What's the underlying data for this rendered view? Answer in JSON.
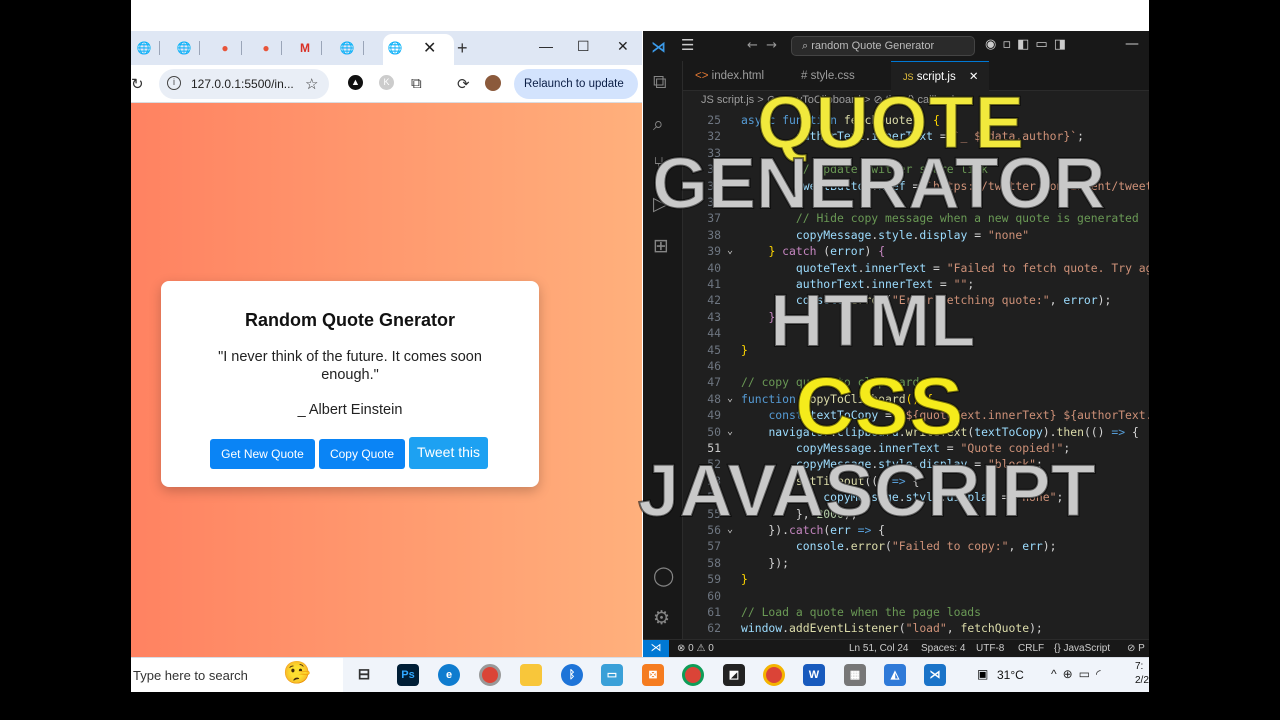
{
  "browser": {
    "url": "127.0.0.1:5500/in...",
    "relaunch_label": "Relaunch to update",
    "profile_letter": "K",
    "tab_icons": [
      "globe-icon",
      "globe-icon",
      "shell-icon",
      "shell-icon",
      "gmail-icon",
      "globe-icon",
      "globe-icon"
    ]
  },
  "app": {
    "title": "Random Quote Gnerator",
    "quote": "\"I never think of the future. It comes soon enough.\"",
    "author": "_ Albert Einstein",
    "btn_new": "Get New Quote",
    "btn_copy": "Copy Quote",
    "btn_tweet": "Tweet this",
    "gradient": [
      "#ff8261",
      "#ffb07c"
    ]
  },
  "vscode": {
    "search": "random Quote Generator",
    "tabs": [
      "index.html",
      "style.css",
      "script.js"
    ],
    "breadcrumb": "JS script.js > ⊘ copyToClipboard > ⊘ then() callback",
    "status": {
      "position": "Ln 51, Col 24",
      "spaces": "Spaces: 4",
      "encoding": "UTF-8",
      "eol": "CRLF",
      "language": "{} JavaScript",
      "problems": "⊗ 0 ⚠ 0"
    },
    "line_numbers": [
      "25",
      "32",
      "33",
      "34",
      "35",
      "36",
      "37",
      "38",
      "39",
      "40",
      "41",
      "42",
      "43",
      "44",
      "45",
      "46",
      "47",
      "48",
      "49",
      "50",
      "51",
      "52",
      "53",
      "54",
      "55",
      "56",
      "57",
      "58",
      "59",
      "60",
      "61",
      "62"
    ]
  },
  "overlay": {
    "quote": "QUOTE",
    "generator": "GENERATOR",
    "html": "HTML",
    "css": "CSS",
    "javascript": "JAVASCRIPT"
  },
  "taskbar": {
    "search_placeholder": "Type here to search",
    "temperature": "31°C",
    "clock_time": "7:",
    "clock_date": "2/2"
  }
}
